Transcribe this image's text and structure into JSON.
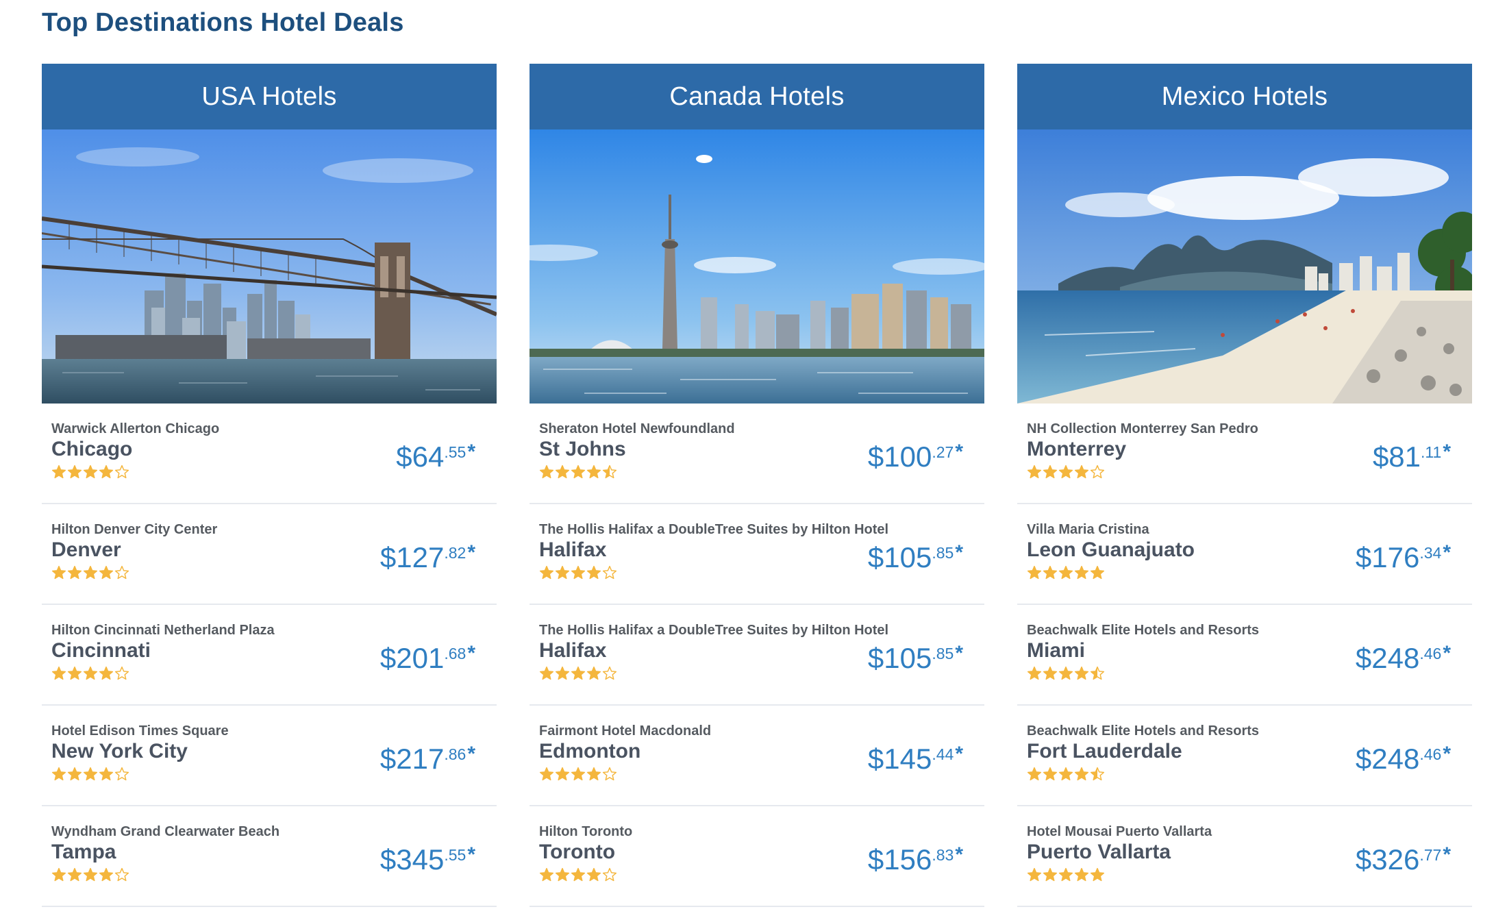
{
  "page_title": "Top Destinations Hotel Deals",
  "colors": {
    "title": "#1d4f7e",
    "header_bg": "#2d6aa8",
    "price": "#2f7ec1",
    "star": "#f4b63d",
    "text": "#4a5361",
    "divider": "#e6e9ee"
  },
  "columns": [
    {
      "title": "USA Hotels",
      "image": "brooklyn-bridge-skyline-photo",
      "deals": [
        {
          "hotel": "Warwick Allerton Chicago",
          "city": "Chicago",
          "price": "$64",
          "cents": ".55",
          "suffix": "*",
          "rating": 4
        },
        {
          "hotel": "Hilton Denver City Center",
          "city": "Denver",
          "price": "$127",
          "cents": ".82",
          "suffix": "*",
          "rating": 4
        },
        {
          "hotel": "Hilton Cincinnati Netherland Plaza",
          "city": "Cincinnati",
          "price": "$201",
          "cents": ".68",
          "suffix": "*",
          "rating": 4
        },
        {
          "hotel": "Hotel Edison Times Square",
          "city": "New York City",
          "price": "$217",
          "cents": ".86",
          "suffix": "*",
          "rating": 4
        },
        {
          "hotel": "Wyndham Grand Clearwater Beach",
          "city": "Tampa",
          "price": "$345",
          "cents": ".55",
          "suffix": "*",
          "rating": 4
        }
      ]
    },
    {
      "title": "Canada Hotels",
      "image": "toronto-cn-tower-skyline-photo",
      "deals": [
        {
          "hotel": "Sheraton Hotel Newfoundland",
          "city": "St Johns",
          "price": "$100",
          "cents": ".27",
          "suffix": "*",
          "rating": 4.5
        },
        {
          "hotel": "The Hollis Halifax a DoubleTree Suites by Hilton Hotel",
          "city": "Halifax",
          "price": "$105",
          "cents": ".85",
          "suffix": "*",
          "rating": 4
        },
        {
          "hotel": "The Hollis Halifax a DoubleTree Suites by Hilton Hotel",
          "city": "Halifax",
          "price": "$105",
          "cents": ".85",
          "suffix": "*",
          "rating": 4
        },
        {
          "hotel": "Fairmont Hotel Macdonald",
          "city": "Edmonton",
          "price": "$145",
          "cents": ".44",
          "suffix": "*",
          "rating": 4
        },
        {
          "hotel": "Hilton Toronto",
          "city": "Toronto",
          "price": "$156",
          "cents": ".83",
          "suffix": "*",
          "rating": 4
        }
      ]
    },
    {
      "title": "Mexico Hotels",
      "image": "beach-mountains-photo",
      "deals": [
        {
          "hotel": "NH Collection Monterrey San Pedro",
          "city": "Monterrey",
          "price": "$81",
          "cents": ".11",
          "suffix": "*",
          "rating": 4
        },
        {
          "hotel": "Villa Maria Cristina",
          "city": "Leon Guanajuato",
          "price": "$176",
          "cents": ".34",
          "suffix": "*",
          "rating": 5
        },
        {
          "hotel": "Beachwalk Elite Hotels and Resorts",
          "city": "Miami",
          "price": "$248",
          "cents": ".46",
          "suffix": "*",
          "rating": 4.5
        },
        {
          "hotel": "Beachwalk Elite Hotels and Resorts",
          "city": "Fort Lauderdale",
          "price": "$248",
          "cents": ".46",
          "suffix": "*",
          "rating": 4.5
        },
        {
          "hotel": "Hotel Mousai Puerto Vallarta",
          "city": "Puerto Vallarta",
          "price": "$326",
          "cents": ".77",
          "suffix": "*",
          "rating": 5
        }
      ]
    }
  ]
}
